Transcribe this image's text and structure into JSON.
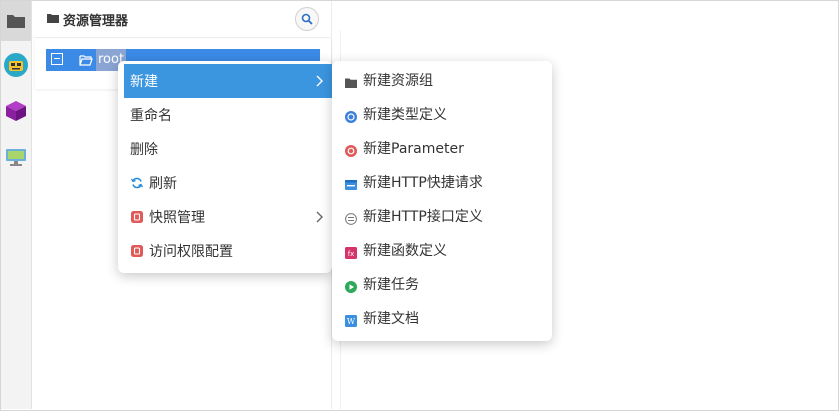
{
  "explorer": {
    "title": "资源管理器"
  },
  "tree": {
    "root_label": "root"
  },
  "activity_bar": {
    "items": [
      {
        "icon": "folder-icon"
      },
      {
        "icon": "bot-avatar-icon"
      },
      {
        "icon": "package-box-icon"
      },
      {
        "icon": "monitor-icon"
      }
    ]
  },
  "context_menu": {
    "items": [
      {
        "label": "新建",
        "icon": "",
        "submenu": true
      },
      {
        "label": "重命名",
        "icon": ""
      },
      {
        "label": "删除",
        "icon": ""
      },
      {
        "label": "刷新",
        "icon": "refresh-icon"
      },
      {
        "label": "快照管理",
        "icon": "snapshot-icon",
        "submenu": true
      },
      {
        "label": "访问权限配置",
        "icon": "permission-icon"
      }
    ]
  },
  "new_submenu": {
    "items": [
      {
        "label": "新建资源组",
        "icon": "folder-icon"
      },
      {
        "label": "新建类型定义",
        "icon": "type-definition-icon"
      },
      {
        "label": "新建Parameter",
        "icon": "parameter-icon"
      },
      {
        "label": "新建HTTP快捷请求",
        "icon": "http-request-icon"
      },
      {
        "label": "新建HTTP接口定义",
        "icon": "http-interface-icon"
      },
      {
        "label": "新建函数定义",
        "icon": "function-icon"
      },
      {
        "label": "新建任务",
        "icon": "task-play-icon"
      },
      {
        "label": "新建文档",
        "icon": "document-icon"
      }
    ]
  },
  "colors": {
    "accent": "#3b95df",
    "selection": "#3b8ae6",
    "danger": "#e05a5a",
    "success": "#2ea85a",
    "function": "#d6336c"
  }
}
